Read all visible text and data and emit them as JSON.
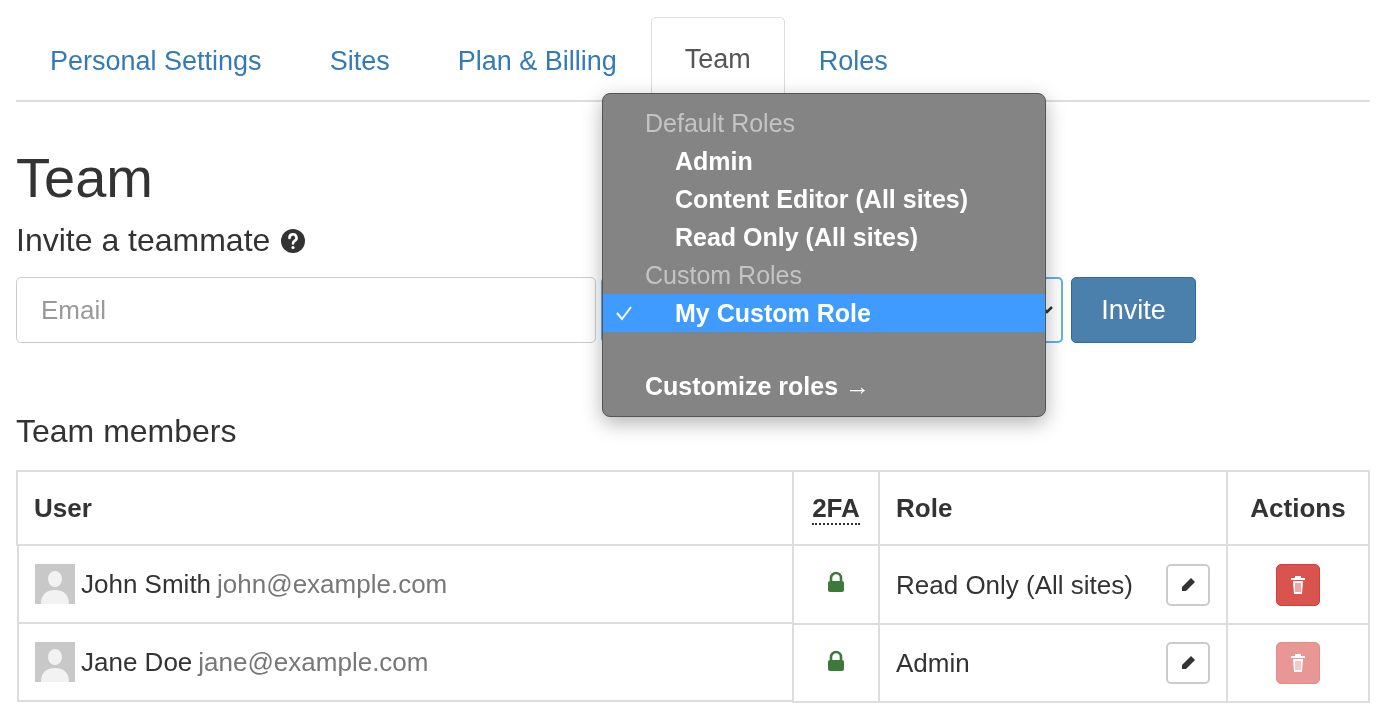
{
  "tabs": [
    {
      "label": "Personal Settings",
      "selected": false
    },
    {
      "label": "Sites",
      "selected": false
    },
    {
      "label": "Plan & Billing",
      "selected": false
    },
    {
      "label": "Team",
      "selected": true
    },
    {
      "label": "Roles",
      "selected": false
    }
  ],
  "page_title": "Team",
  "invite": {
    "heading": "Invite a teammate",
    "email": {
      "placeholder": "Email"
    },
    "button": "Invite"
  },
  "role_menu": {
    "groups": [
      {
        "header": "Default Roles",
        "options": [
          {
            "label": "Admin",
            "selected": false
          },
          {
            "label": "Content Editor (All sites)",
            "selected": false
          },
          {
            "label": "Read Only (All sites)",
            "selected": false
          }
        ]
      },
      {
        "header": "Custom Roles",
        "options": [
          {
            "label": "My Custom Role",
            "selected": true
          }
        ]
      }
    ],
    "footer_link": "Customize roles →"
  },
  "members": {
    "heading": "Team members",
    "columns": [
      "User",
      "2FA",
      "Role",
      "Actions"
    ],
    "rows": [
      {
        "name": "John Smith",
        "email": "john@example.com",
        "twofa": true,
        "role": "Read Only (All sites)",
        "delete_disabled": false
      },
      {
        "name": "Jane Doe",
        "email": "jane@example.com",
        "twofa": true,
        "role": "Admin",
        "delete_disabled": true
      }
    ]
  }
}
